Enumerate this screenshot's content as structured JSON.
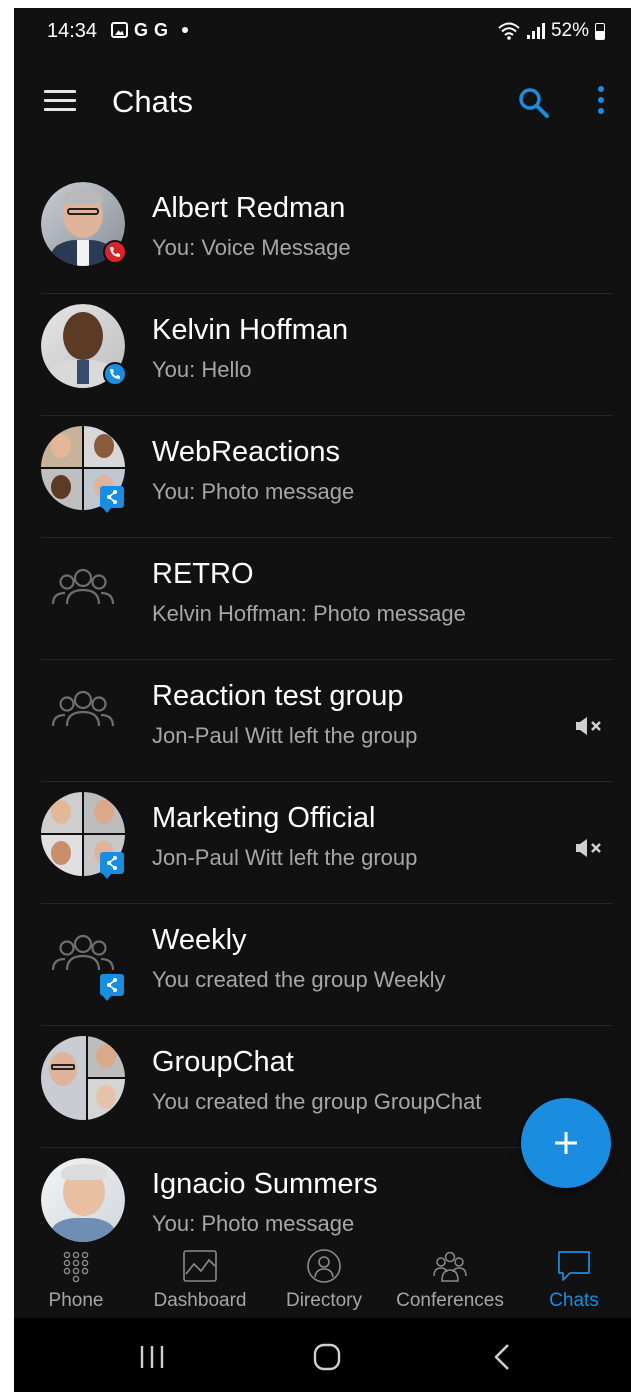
{
  "status_bar": {
    "time": "14:34",
    "battery": "52%"
  },
  "app_bar": {
    "title": "Chats",
    "menu_icon": "hamburger-menu-icon",
    "search_icon": "search-icon",
    "more_icon": "more-vertical-icon"
  },
  "chats": [
    {
      "name": "Albert Redman",
      "preview": "You: Voice Message",
      "avatar": "photo",
      "badge": "missed-call-icon",
      "muted": false
    },
    {
      "name": "Kelvin Hoffman",
      "preview": "You: Hello",
      "avatar": "photo",
      "badge": "call-icon",
      "muted": false
    },
    {
      "name": "WebReactions",
      "preview": "You: Photo message",
      "avatar": "mosaic",
      "badge": "shared-chat-icon",
      "muted": false
    },
    {
      "name": "RETRO",
      "preview": "Kelvin Hoffman: Photo message",
      "avatar": "group-outline",
      "badge": "",
      "muted": false
    },
    {
      "name": "Reaction test group",
      "preview": "Jon-Paul Witt left the group",
      "avatar": "group-outline",
      "badge": "",
      "muted": true
    },
    {
      "name": "Marketing Official",
      "preview": "Jon-Paul Witt left the group",
      "avatar": "mosaic",
      "badge": "shared-chat-icon",
      "muted": true
    },
    {
      "name": "Weekly",
      "preview": "You created the group Weekly",
      "avatar": "group-outline",
      "badge": "shared-chat-icon",
      "muted": false
    },
    {
      "name": "GroupChat",
      "preview": "You created the group GroupChat",
      "avatar": "mosaic",
      "badge": "",
      "muted": false
    },
    {
      "name": "Ignacio Summers",
      "preview": "You: Photo message",
      "avatar": "photo",
      "badge": "",
      "muted": false
    }
  ],
  "fab": {
    "icon": "plus-icon"
  },
  "bottom_nav": {
    "items": [
      {
        "label": "Phone",
        "icon": "dialpad-icon",
        "active": false
      },
      {
        "label": "Dashboard",
        "icon": "dashboard-chart-icon",
        "active": false
      },
      {
        "label": "Directory",
        "icon": "contact-directory-icon",
        "active": false
      },
      {
        "label": "Conferences",
        "icon": "conference-group-icon",
        "active": false
      },
      {
        "label": "Chats",
        "icon": "chat-bubble-icon",
        "active": true
      }
    ]
  },
  "system_nav": {
    "recents_icon": "recents-icon",
    "home_icon": "home-icon",
    "back_icon": "back-icon"
  },
  "colors": {
    "background": "#111111",
    "accent": "#1a8de0",
    "text_primary": "#ffffff",
    "text_secondary": "#a6a6a6",
    "badge_red": "#d9242c"
  }
}
